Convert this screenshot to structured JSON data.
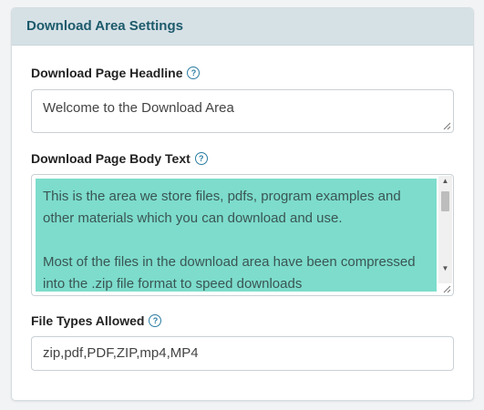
{
  "panel": {
    "title": "Download Area Settings"
  },
  "fields": {
    "headline": {
      "label": "Download Page Headline",
      "help_icon": "?",
      "value": "Welcome to the Download Area"
    },
    "body_text": {
      "label": "Download Page Body Text",
      "help_icon": "?",
      "paragraph_1": "This is the area we store files, pdfs, program examples and other materials which you can download and use.",
      "paragraph_2": "Most of the files in the download area have been compressed into the .zip file format to speed downloads",
      "highlight_color": "#7ddccc"
    },
    "file_types": {
      "label": "File Types Allowed",
      "help_icon": "?",
      "value": "zip,pdf,PDF,ZIP,mp4,MP4"
    }
  },
  "scrollbar": {
    "up_arrow": "▲",
    "down_arrow": "▼"
  },
  "colors": {
    "header_bg": "#d6e1e6",
    "header_text": "#1c5a6b",
    "help_icon": "#2a7ca2"
  }
}
